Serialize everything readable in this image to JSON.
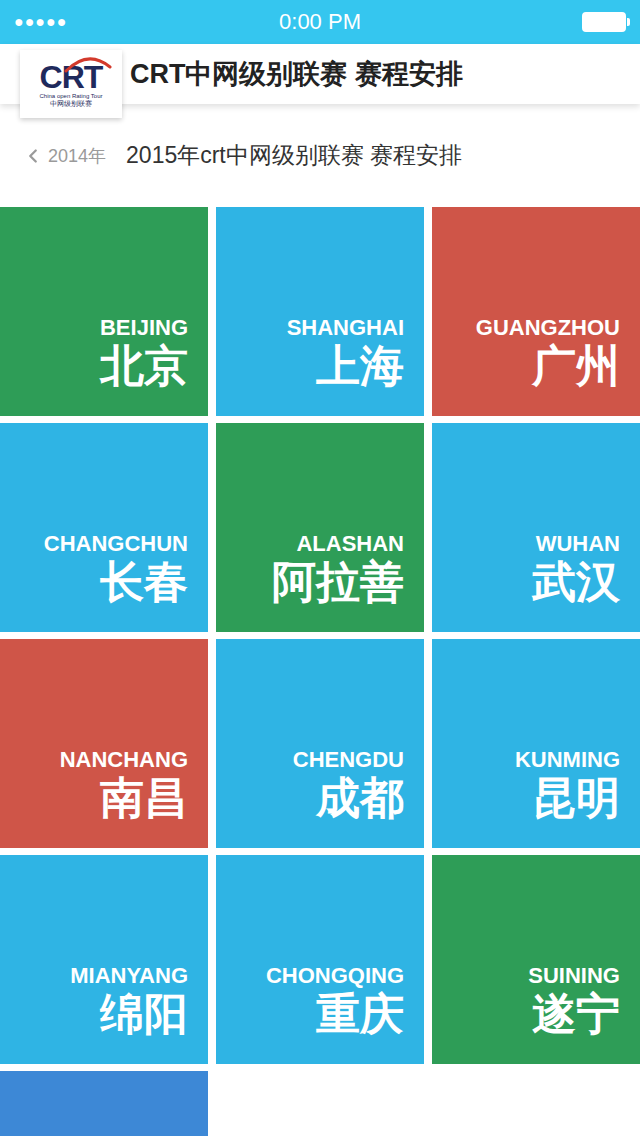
{
  "status_bar": {
    "signal": "●●●●●",
    "time": "0:00 PM"
  },
  "header": {
    "logo": {
      "mark": "CRT",
      "subtitle": "China open Rating Tour",
      "caption": "中网级别联赛"
    },
    "title": "CRT中网级别联赛 赛程安排"
  },
  "nav": {
    "back": "2014年",
    "title": "2015年crt中网级别联赛 赛程安排"
  },
  "cities": [
    {
      "en": "BEIJING",
      "cn": "北京",
      "color": "#2e9d57"
    },
    {
      "en": "SHANGHAI",
      "cn": "上海",
      "color": "#2fb4e4"
    },
    {
      "en": "GUANGZHOU",
      "cn": "广州",
      "color": "#cf5548"
    },
    {
      "en": "CHANGCHUN",
      "cn": "长春",
      "color": "#2fb4e4"
    },
    {
      "en": "ALASHAN",
      "cn": "阿拉善",
      "color": "#2e9d57"
    },
    {
      "en": "WUHAN",
      "cn": "武汉",
      "color": "#2fb4e4"
    },
    {
      "en": "NANCHANG",
      "cn": "南昌",
      "color": "#cf5548"
    },
    {
      "en": "CHENGDU",
      "cn": "成都",
      "color": "#2fb4e4"
    },
    {
      "en": "KUNMING",
      "cn": "昆明",
      "color": "#2fb4e4"
    },
    {
      "en": "MIANYANG",
      "cn": "绵阳",
      "color": "#2fb4e4"
    },
    {
      "en": "CHONGQING",
      "cn": "重庆",
      "color": "#2fb4e4"
    },
    {
      "en": "SUINING",
      "cn": "遂宁",
      "color": "#2e9d57"
    },
    {
      "en": "",
      "cn": "",
      "color": "#3d88d6"
    }
  ]
}
